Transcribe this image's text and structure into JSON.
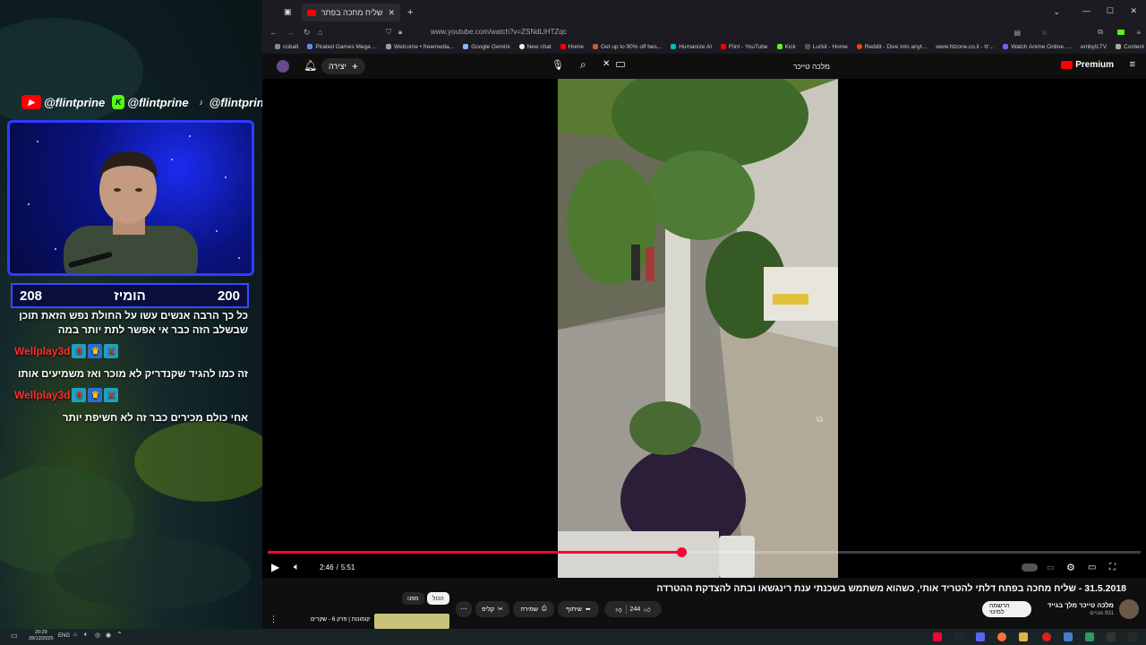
{
  "overlay": {
    "socials": [
      {
        "platform": "youtube",
        "handle": "@flintprine",
        "color": "#ff0000"
      },
      {
        "platform": "kick",
        "handle": "@flintprine",
        "color": "#53fc18"
      },
      {
        "platform": "tiktok",
        "handle": "@flintprine",
        "color": "#111111"
      }
    ],
    "score": {
      "left": "208",
      "center": "הומיז",
      "right": "200"
    },
    "chat": [
      {
        "type": "message",
        "text": "כל כך הרבה אנשים עשו על החולת נפש הזאת תוכן"
      },
      {
        "type": "message",
        "text": "שבשלב הזה כבר אי אפשר לתת יותר במה"
      },
      {
        "type": "user",
        "name": "Wellplay3d"
      },
      {
        "type": "message",
        "text": "זה כמו להגיד שקנדריק לא מוכר ואז משמיעים אותו"
      },
      {
        "type": "user",
        "name": "Wellplay3d"
      },
      {
        "type": "message",
        "text": "אחי כולם מכירים כבר זה לא חשיפת יותר"
      }
    ]
  },
  "browser": {
    "tab_title": "שליח מחכה בפתח - 31.5.2018",
    "url": "www.youtube.com/watch?v=ZSNdLlHTZqc",
    "bookmarks": [
      "cobalt",
      "Pirated Games Mega ...",
      "Welcome • freemedia...",
      "Google Gemini",
      "New chat",
      "Home",
      "Get up to 90% off bes...",
      "Humanize AI",
      "Flint - YouTube",
      "Kick",
      "Lurkit - Home",
      "Reddit - Dive into anyt...",
      "www.htzone.co.il - ס'...",
      "Watch Anime Online, ...",
      "embyILTV",
      "Content"
    ],
    "bookmark_colors": [
      "#888888",
      "#5b8def",
      "#9aa0a6",
      "#8ab4f8",
      "#eeeeee",
      "#ff0000",
      "#c06030",
      "#00c2b8",
      "#ff0000",
      "#53fc18",
      "#555555",
      "#ff4500",
      "#aaaaaa",
      "#7b5cff",
      "#aaaaaa",
      "#aaaaaa"
    ]
  },
  "youtube": {
    "logo_text": "Premium",
    "create_label": "יצירה",
    "search_query": "מלכה טייכר",
    "time_current": "2:46",
    "time_separator": "/",
    "time_total": "5:51",
    "progress_fraction": 0.474,
    "video_title": "31.5.2018 - שליח מחכה בפתח דלתי להטריד אותי, כשהוא משתמש בשכנתי ענת רינגשאו ובתה להצדקת ההטרדה",
    "channel_name": "מלכה טייכר מלך בגייד",
    "subscribers": "931 מנויים",
    "subscribe_label": "הרשמה למינוי",
    "like_count": "244",
    "share_label": "שיתוף",
    "save_label": "שמירה",
    "clip_label": "קליפ",
    "chips": {
      "all": "הכול",
      "related": "מפנו"
    },
    "up_next": "קומונות | פרק 6 - שקרים"
  },
  "taskbar": {
    "language": "ENG",
    "time": "20:29",
    "date": "28/12/2025"
  }
}
